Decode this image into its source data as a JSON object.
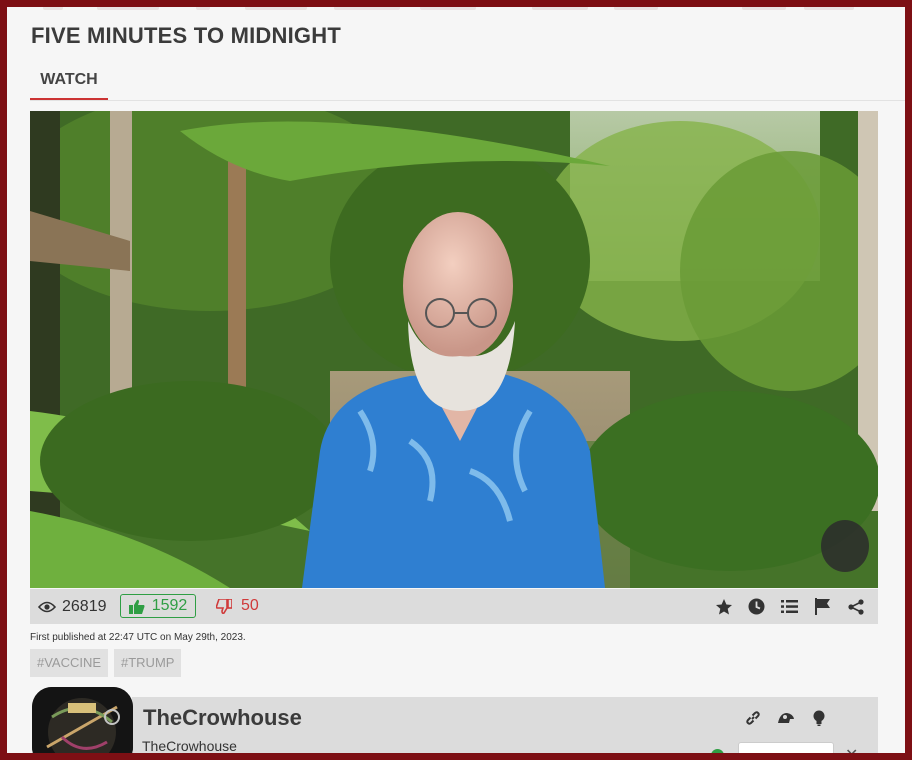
{
  "page": {
    "title": "FIVE MINUTES TO MIDNIGHT",
    "tabs": [
      {
        "label": "WATCH"
      }
    ]
  },
  "video": {
    "stats": {
      "views": "26819",
      "likes": "1592",
      "dislikes": "50"
    },
    "actions": [
      "star-icon",
      "clock-icon",
      "list-icon",
      "flag-icon",
      "share-icon"
    ],
    "published": "First published at 22:47 UTC on May 29th, 2023.",
    "tags": [
      "#VACCINE",
      "#TRUMP"
    ]
  },
  "channel": {
    "name": "TheCrowhouse",
    "handle": "TheCrowhouse",
    "icons": [
      "link-icon",
      "donate-icon",
      "lightbulb-icon"
    ]
  },
  "colors": {
    "border": "#7d0f14",
    "accent": "#cc3333",
    "like": "#2f9e44",
    "dislike": "#d03a3a"
  }
}
